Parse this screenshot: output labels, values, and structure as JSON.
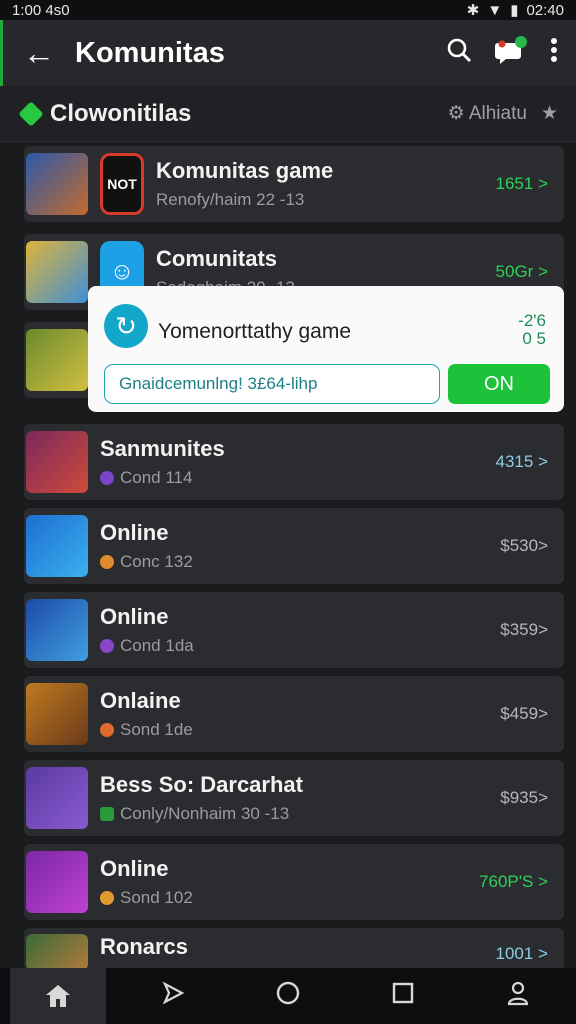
{
  "status_bar": {
    "left": "1:00 4s0",
    "right": "02:40"
  },
  "app_bar": {
    "title": "Komunitas",
    "back_icon": "arrow-left-icon"
  },
  "section": {
    "title": "Clowonitilas",
    "settings_label": "Alhiatu"
  },
  "rows": [
    {
      "title": "Komunitas game",
      "sub": "Renofy/haim 22 -13",
      "value": "1651 >",
      "value_color": "#2ed15a",
      "thumb": [
        "#2a5aa8",
        "#c56a2e"
      ],
      "badge": "NOT",
      "badge_bg": "#111111",
      "badge_color": "#ffffff",
      "dot": ""
    },
    {
      "title": "Comunitats",
      "sub": "Sodoghaim 20 -13",
      "value": "50Gr >",
      "value_color": "#2ed15a",
      "thumb": [
        "#e0b43a",
        "#3d8fd6"
      ],
      "badge": "☺",
      "badge_bg": "#1da1e6",
      "badge_color": "#ffffff",
      "dot": ""
    },
    {
      "title": "",
      "sub": "",
      "value": "",
      "value_color": "#2ed15a",
      "thumb": [
        "#6a8a2e",
        "#d2c040"
      ],
      "badge": "",
      "badge_bg": "",
      "badge_color": "",
      "dot": ""
    },
    {
      "title": "Sanmunites",
      "sub": "Cond 114",
      "value": "4315 >",
      "value_color": "#8ecbe6",
      "thumb": [
        "#7a2a5a",
        "#d04a3a"
      ],
      "badge": "",
      "badge_bg": "",
      "badge_color": "",
      "dot": "#7a43c8"
    },
    {
      "title": "Online",
      "sub": "Conc 132",
      "value": "$530>",
      "value_color": "#b4b6ba",
      "thumb": [
        "#1d6fd0",
        "#3ab0f0"
      ],
      "badge": "",
      "badge_bg": "",
      "badge_color": "",
      "dot": "#e08a2e"
    },
    {
      "title": "Online",
      "sub": "Cond 1da",
      "value": "$359>",
      "value_color": "#b4b6ba",
      "thumb": [
        "#1e4aa8",
        "#40a0e0"
      ],
      "badge": "",
      "badge_bg": "",
      "badge_color": "",
      "dot": "#8a44c8"
    },
    {
      "title": "Onlaine",
      "sub": "Sond 1de",
      "value": "$459>",
      "value_color": "#b4b6ba",
      "thumb": [
        "#c07a20",
        "#6a3a1a"
      ],
      "badge": "",
      "badge_bg": "",
      "badge_color": "",
      "dot": "#e06a2e"
    },
    {
      "title": "Bess So: Darcarhat",
      "sub": "Conly/Nonhaim 30 -13",
      "value": "$935>",
      "value_color": "#b4b6ba",
      "thumb": [
        "#5a3aa0",
        "#8a5ad0"
      ],
      "badge": "",
      "badge_bg": "",
      "badge_color": "",
      "dot": "#2a9a3a"
    },
    {
      "title": "Online",
      "sub": "Sond 102",
      "value": "760P'S >",
      "value_color": "#2ed15a",
      "thumb": [
        "#7a28a8",
        "#c040d0"
      ],
      "badge": "",
      "badge_bg": "",
      "badge_color": "",
      "dot": "#e09a2e"
    },
    {
      "title": "Ronarcs",
      "sub": "",
      "value": "1001 >",
      "value_color": "#8ecbe6",
      "thumb": [
        "#3a6a3a",
        "#b07a3a"
      ],
      "badge": "",
      "badge_bg": "",
      "badge_color": "",
      "dot": ""
    }
  ],
  "popup": {
    "title": "Yomenorttathy game",
    "value_top": "-2'6",
    "value_bottom": "0 5",
    "input_value": "Gnaidcemunlng! 3£64-lihp",
    "toggle_label": "ON"
  },
  "bottom_nav": {
    "items": [
      "home-icon",
      "send-icon",
      "circle-icon",
      "square-icon",
      "profile-icon"
    ]
  }
}
